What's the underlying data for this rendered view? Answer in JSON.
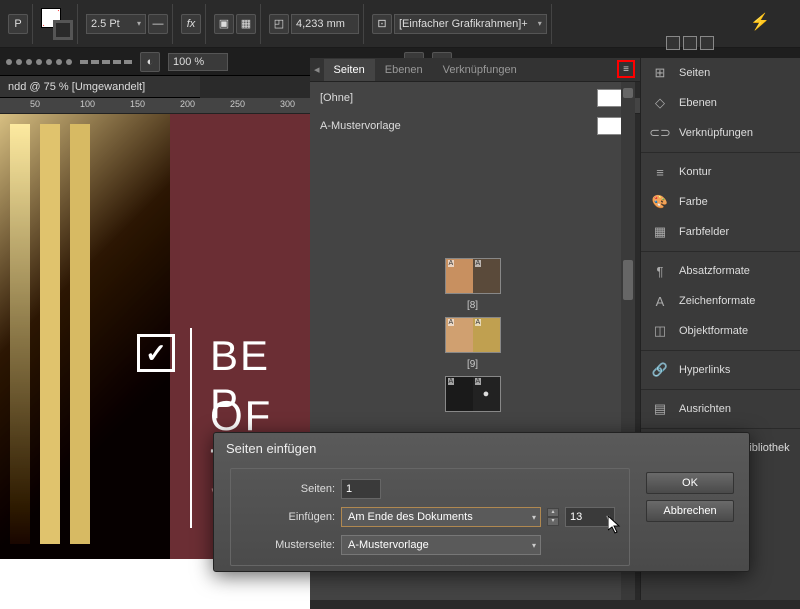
{
  "toolbar": {
    "stroke_weight": "2.5 Pt",
    "dimension": "4,233 mm",
    "frame_style": "[Einfacher Grafikrahmen]+",
    "opacity": "100 %"
  },
  "document": {
    "tab_title": "ndd @ 75 % [Umgewandelt]",
    "ruler_marks": [
      "50",
      "100",
      "150",
      "200",
      "250",
      "300"
    ]
  },
  "canvas": {
    "line1": "BE P",
    "line2": "OF T",
    "line3": "SOL"
  },
  "panels": {
    "tabs": [
      "Seiten",
      "Ebenen",
      "Verknüpfungen"
    ],
    "masters": [
      {
        "name": "[Ohne]"
      },
      {
        "name": "A-Mustervorlage"
      }
    ],
    "page_labels": [
      "[8]",
      "[9]"
    ]
  },
  "right_panel": [
    {
      "icon": "⊞",
      "label": "Seiten"
    },
    {
      "icon": "◇",
      "label": "Ebenen"
    },
    {
      "icon": "⊂⊃",
      "label": "Verknüpfungen"
    },
    {
      "sep": true
    },
    {
      "icon": "≡",
      "label": "Kontur"
    },
    {
      "icon": "🎨",
      "label": "Farbe"
    },
    {
      "icon": "▦",
      "label": "Farbfelder"
    },
    {
      "sep": true
    },
    {
      "icon": "¶",
      "label": "Absatzformate"
    },
    {
      "icon": "A",
      "label": "Zeichenformate"
    },
    {
      "icon": "◫",
      "label": "Objektformate"
    },
    {
      "sep": true
    },
    {
      "icon": "🔗",
      "label": "Hyperlinks"
    },
    {
      "sep": true
    },
    {
      "icon": "▤",
      "label": "Ausrichten"
    },
    {
      "sep": true
    },
    {
      "icon": "▣",
      "label": "4eck_Media-Bibliothek"
    }
  ],
  "dialog": {
    "title": "Seiten einfügen",
    "labels": {
      "pages": "Seiten:",
      "insert": "Einfügen:",
      "master": "Musterseite:"
    },
    "values": {
      "pages": "1",
      "insert": "Am Ende des Dokuments",
      "page_num": "13",
      "master": "A-Mustervorlage"
    },
    "buttons": {
      "ok": "OK",
      "cancel": "Abbrechen"
    }
  }
}
